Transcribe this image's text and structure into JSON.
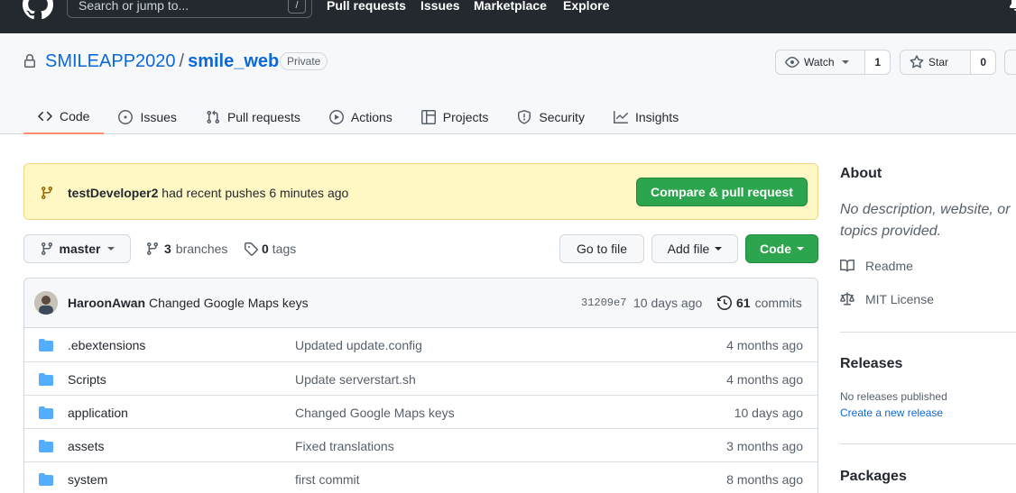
{
  "header": {
    "search_placeholder": "Search or jump to...",
    "search_shortcut": "/",
    "nav": [
      "Pull requests",
      "Issues",
      "Marketplace",
      "Explore"
    ]
  },
  "repo": {
    "owner": "SMILEAPP2020",
    "separator": "/",
    "name": "smile_web",
    "visibility": "Private",
    "watch_label": "Watch",
    "watch_count": "1",
    "star_label": "Star",
    "star_count": "0"
  },
  "tabs": [
    {
      "label": "Code",
      "icon": "code-icon"
    },
    {
      "label": "Issues",
      "icon": "issue-opened-icon"
    },
    {
      "label": "Pull requests",
      "icon": "git-pull-request-icon"
    },
    {
      "label": "Actions",
      "icon": "play-icon"
    },
    {
      "label": "Projects",
      "icon": "table-icon"
    },
    {
      "label": "Security",
      "icon": "shield-icon"
    },
    {
      "label": "Insights",
      "icon": "graph-icon"
    }
  ],
  "flash": {
    "user": "testDeveloper2",
    "message": "had recent pushes 6 minutes ago",
    "button": "Compare & pull request"
  },
  "toolbar": {
    "branch": "master",
    "branches_count": "3",
    "branches_label": "branches",
    "tags_count": "0",
    "tags_label": "tags",
    "go_to_file": "Go to file",
    "add_file": "Add file",
    "code": "Code"
  },
  "latest_commit": {
    "author": "HaroonAwan",
    "message": "Changed Google Maps keys",
    "sha": "31209e7",
    "time": "10 days ago",
    "commits_count": "61",
    "commits_label": "commits"
  },
  "files": [
    {
      "name": ".ebextensions",
      "message": "Updated update.config",
      "age": "4 months ago"
    },
    {
      "name": "Scripts",
      "message": "Update serverstart.sh",
      "age": "4 months ago"
    },
    {
      "name": "application",
      "message": "Changed Google Maps keys",
      "age": "10 days ago"
    },
    {
      "name": "assets",
      "message": "Fixed translations",
      "age": "3 months ago"
    },
    {
      "name": "system",
      "message": "first commit",
      "age": "8 months ago"
    }
  ],
  "sidebar": {
    "about_title": "About",
    "about_desc": "No description, website, or topics provided.",
    "readme": "Readme",
    "license": "MIT License",
    "releases_title": "Releases",
    "releases_none": "No releases published",
    "releases_create": "Create a new release",
    "packages_title": "Packages"
  },
  "colors": {
    "header_bg": "#24292f",
    "accent_green": "#2da44e",
    "link_blue": "#0969da",
    "flash_bg": "#fff8c5",
    "tab_underline": "#fd8c73",
    "folder_blue": "#54aeff"
  }
}
